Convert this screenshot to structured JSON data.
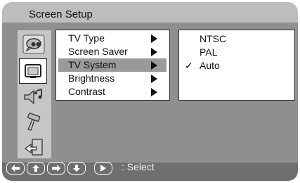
{
  "title": "Screen Setup",
  "sidebar_icons": [
    {
      "name": "speech-bubble-icon",
      "selected": false
    },
    {
      "name": "tv-screen-icon",
      "selected": true
    },
    {
      "name": "audio-speaker-icon",
      "selected": false
    },
    {
      "name": "hammer-tool-icon",
      "selected": false
    },
    {
      "name": "exit-arrow-icon",
      "selected": false
    }
  ],
  "menu": {
    "items": [
      {
        "label": "TV Type",
        "active": false
      },
      {
        "label": "Screen Saver",
        "active": false
      },
      {
        "label": "TV System",
        "active": true
      },
      {
        "label": "Brightness",
        "active": false
      },
      {
        "label": "Contrast",
        "active": false
      }
    ]
  },
  "options": {
    "items": [
      "NTSC",
      "PAL",
      "Auto"
    ],
    "checked": "Auto",
    "check_mark": "✓"
  },
  "footer": {
    "keys": [
      "left-arrow-key-icon",
      "up-arrow-key-icon",
      "right-arrow-key-icon",
      "down-arrow-key-icon",
      "play-key-icon"
    ],
    "hint": ": Select"
  },
  "colors": {
    "header_gray": "#bdbdbd",
    "body_gray": "#8f8f8f",
    "footer_gray": "#6f6f6f",
    "highlight_gray": "#9a9a9a"
  }
}
